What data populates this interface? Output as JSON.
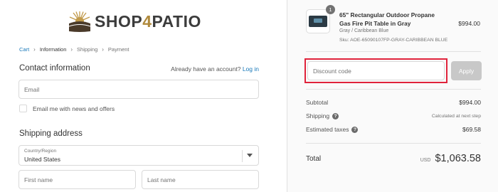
{
  "brand": {
    "name_part1": "SHOP",
    "name_part2": "4",
    "name_part3": "PATIO"
  },
  "breadcrumb": {
    "cart": "Cart",
    "information": "Information",
    "shipping": "Shipping",
    "payment": "Payment"
  },
  "contact": {
    "title": "Contact information",
    "account_prompt": "Already have an account?",
    "login_link": "Log in",
    "email_placeholder": "Email",
    "newsletter_label": "Email me with news and offers"
  },
  "shipping_address": {
    "title": "Shipping address",
    "country_label": "Country/Region",
    "country_value": "United States",
    "first_name_placeholder": "First name",
    "last_name_placeholder": "Last name"
  },
  "order": {
    "quantity": "1",
    "product_name": "65\" Rectangular Outdoor Propane Gas Fire Pit Table in Gray",
    "variant": "Gray / Caribbean Blue",
    "sku": "Sku: AOE-65090107FP-GRAY-CARIBBEAN BLUE",
    "price": "$994.00"
  },
  "discount": {
    "placeholder": "Discount code",
    "apply_label": "Apply"
  },
  "summary": {
    "subtotal_label": "Subtotal",
    "subtotal_value": "$994.00",
    "shipping_label": "Shipping",
    "shipping_value": "Calculated at next step",
    "taxes_label": "Estimated taxes",
    "taxes_value": "$69.58",
    "total_label": "Total",
    "currency": "USD",
    "total_value": "$1,063.58"
  },
  "colors": {
    "link": "#1878b9",
    "highlight": "#e0233b",
    "brand_gold": "#b08a3c",
    "apply_disabled": "#c8c8c8"
  }
}
